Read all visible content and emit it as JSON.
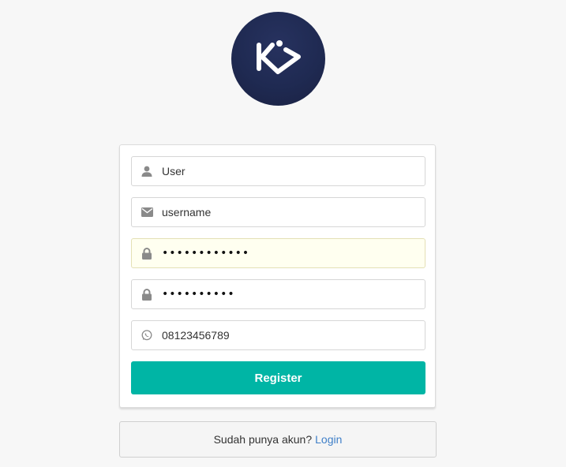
{
  "logo": {
    "icon": "kp-logo-icon",
    "bg_color": "#1f2a52"
  },
  "form": {
    "fields": [
      {
        "icon": "user-icon",
        "value": "User",
        "type": "text"
      },
      {
        "icon": "envelope-icon",
        "value": "username",
        "type": "text"
      },
      {
        "icon": "lock-icon",
        "value": "............",
        "type": "password",
        "autofilled": true
      },
      {
        "icon": "lock-icon",
        "value": "..........",
        "type": "password"
      },
      {
        "icon": "whatsapp-icon",
        "value": "08123456789",
        "type": "text"
      }
    ],
    "register_label": "Register",
    "register_color": "#00b5a5"
  },
  "footer": {
    "prompt": "Sudah punya akun?",
    "login_label": "Login",
    "link_color": "#3f7fc8"
  }
}
